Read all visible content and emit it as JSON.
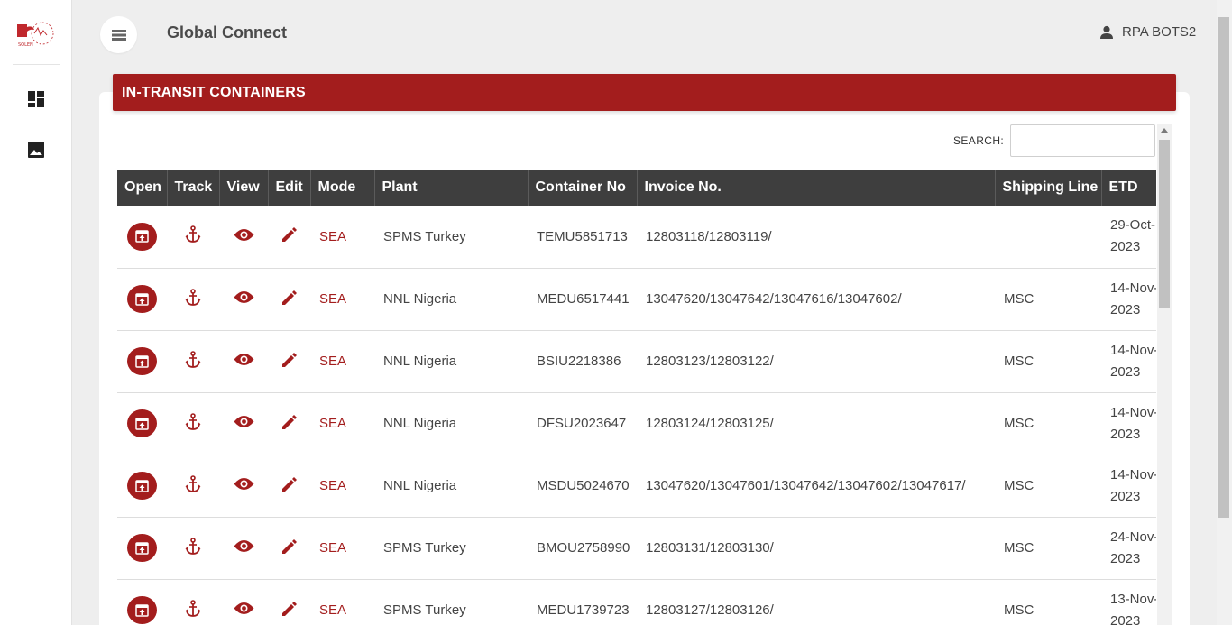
{
  "app": {
    "title": "Global Connect",
    "user": "RPA BOTS2"
  },
  "colors": {
    "accent": "#a31d1d",
    "header_dark": "#3e3e3e"
  },
  "sidebar": {
    "logo_text": "SOLEN",
    "items": [
      {
        "icon": "dashboard-icon"
      },
      {
        "icon": "image-icon"
      }
    ]
  },
  "card": {
    "title": "IN-TRANSIT CONTAINERS"
  },
  "search": {
    "label": "SEARCH:",
    "value": ""
  },
  "table": {
    "columns": [
      "Open",
      "Track",
      "View",
      "Edit",
      "Mode",
      "Plant",
      "Container No",
      "Invoice No.",
      "Shipping Line",
      "ETD"
    ],
    "rows": [
      {
        "mode": "SEA",
        "plant": "SPMS Turkey",
        "container": "TEMU5851713",
        "invoice": "12803118/12803119/",
        "line": "",
        "etd": "29-Oct-2023"
      },
      {
        "mode": "SEA",
        "plant": "NNL Nigeria",
        "container": "MEDU6517441",
        "invoice": "13047620/13047642/13047616/13047602/",
        "line": "MSC",
        "etd": "14-Nov-2023"
      },
      {
        "mode": "SEA",
        "plant": "NNL Nigeria",
        "container": "BSIU2218386",
        "invoice": "12803123/12803122/",
        "line": "MSC",
        "etd": "14-Nov-2023"
      },
      {
        "mode": "SEA",
        "plant": "NNL Nigeria",
        "container": "DFSU2023647",
        "invoice": "12803124/12803125/",
        "line": "MSC",
        "etd": "14-Nov-2023"
      },
      {
        "mode": "SEA",
        "plant": "NNL Nigeria",
        "container": "MSDU5024670",
        "invoice": "13047620/13047601/13047642/13047602/13047617/",
        "line": "MSC",
        "etd": "14-Nov-2023"
      },
      {
        "mode": "SEA",
        "plant": "SPMS Turkey",
        "container": "BMOU2758990",
        "invoice": "12803131/12803130/",
        "line": "MSC",
        "etd": "24-Nov-2023"
      },
      {
        "mode": "SEA",
        "plant": "SPMS Turkey",
        "container": "MEDU1739723",
        "invoice": "12803127/12803126/",
        "line": "MSC",
        "etd": "13-Nov-2023"
      }
    ]
  }
}
